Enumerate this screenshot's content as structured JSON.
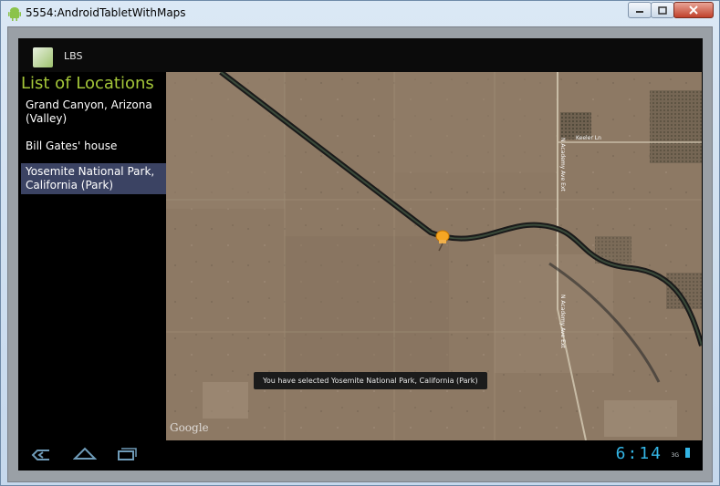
{
  "window": {
    "title": "5554:AndroidTabletWithMaps"
  },
  "app": {
    "name": "LBS"
  },
  "list": {
    "heading": "List of Locations",
    "items": [
      {
        "label": "Grand Canyon, Arizona (Valley)",
        "selected": false
      },
      {
        "label": "Bill Gates' house",
        "selected": false
      },
      {
        "label": "Yosemite National Park, California (Park)",
        "selected": true
      }
    ]
  },
  "map": {
    "provider_logo": "Google",
    "road_labels": [
      "Keeler Ln",
      "N Academy Ave Ext",
      "N Academy Ave Ext"
    ],
    "marker": "pushpin-icon"
  },
  "toast": {
    "message": "You have selected Yosemite National Park, California (Park)"
  },
  "status": {
    "time": "6:14",
    "network": "3G"
  },
  "colors": {
    "accent": "#33b5e5",
    "heading": "#a4c639",
    "selected_bg": "#3b4363"
  }
}
